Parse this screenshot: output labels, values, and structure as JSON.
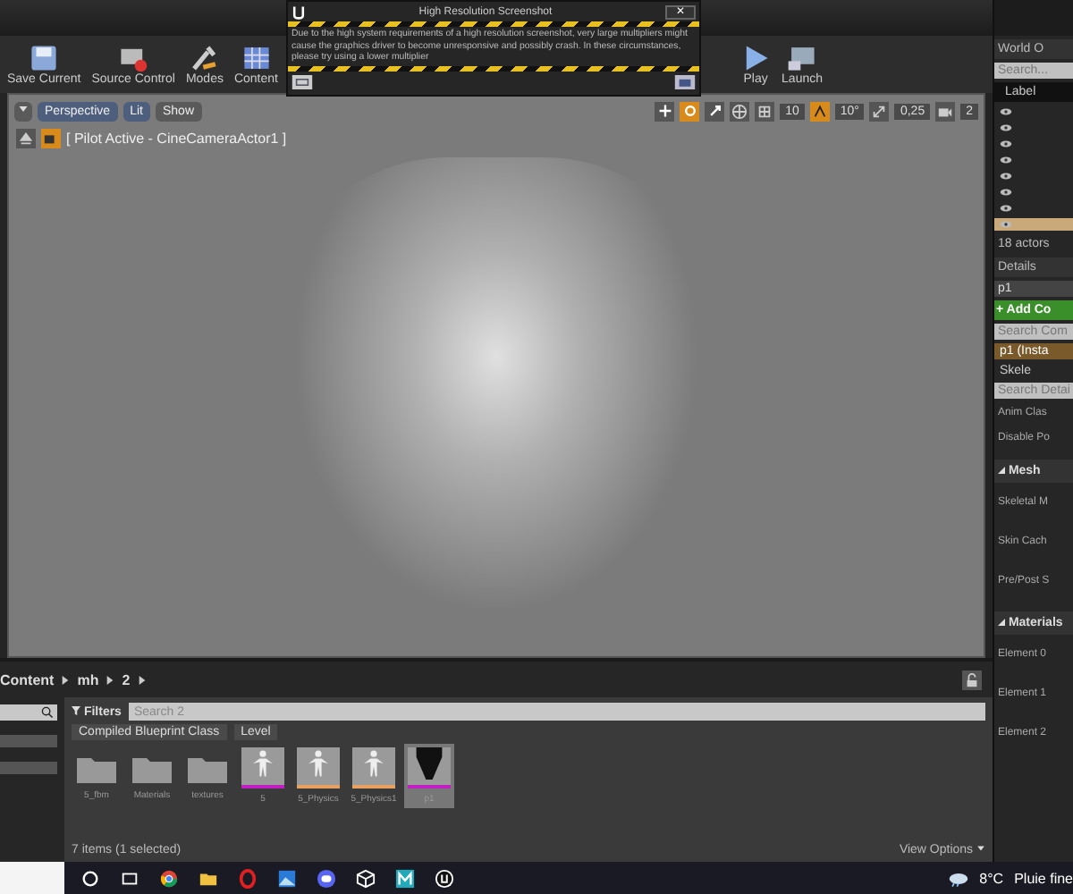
{
  "dialog": {
    "title": "High Resolution Screenshot",
    "close": "✕",
    "message": "Due to the high system requirements of a high resolution screenshot, very large multipliers might cause the graphics driver to become unresponsive and possibly crash. In these circumstances, please try using a lower multiplier"
  },
  "toolbar_left": [
    {
      "label": "Save Current",
      "kind": "save"
    },
    {
      "label": "Source Control",
      "kind": "source"
    },
    {
      "label": "Modes",
      "kind": "modes"
    },
    {
      "label": "Content",
      "kind": "content"
    }
  ],
  "toolbar_right": [
    {
      "label": "Play",
      "kind": "play"
    },
    {
      "label": "Launch",
      "kind": "launch"
    }
  ],
  "viewport": {
    "buttons": [
      {
        "label": "Perspective",
        "kind": "perspective"
      },
      {
        "label": "Lit",
        "kind": "lit"
      },
      {
        "label": "Show",
        "kind": "show"
      }
    ],
    "transform_tools": [
      {
        "kind": "translate",
        "selected": false
      },
      {
        "kind": "rotate",
        "selected": true
      },
      {
        "kind": "scale",
        "selected": false
      }
    ],
    "grid_snap": "10",
    "rotation_snap": "10°",
    "scale_snap": "0,25",
    "camera_speed": "2",
    "pilot": "[ Pilot Active - CineCameraActor1 ]"
  },
  "content_browser": {
    "path": [
      "Content",
      "mh",
      "2"
    ],
    "filters": "Filters",
    "search_placeholder": "Search 2",
    "tags": [
      "Compiled Blueprint Class",
      "Level"
    ],
    "items": [
      {
        "name": "5_fbm",
        "kind": "folder",
        "selected": false
      },
      {
        "name": "Materials",
        "kind": "folder",
        "selected": false
      },
      {
        "name": "textures",
        "kind": "folder",
        "selected": false
      },
      {
        "name": "5",
        "kind": "mesh",
        "color": "#c21fc2",
        "selected": false
      },
      {
        "name": "5_Physics",
        "kind": "mesh",
        "color": "#e8a060",
        "selected": false
      },
      {
        "name": "5_Physics1",
        "kind": "mesh",
        "color": "#e8a060",
        "selected": false
      },
      {
        "name": "p1",
        "kind": "level",
        "color": "#c21fc2",
        "selected": true
      }
    ],
    "status": "7 items (1 selected)",
    "view_options": "View Options"
  },
  "outliner": {
    "title": "World O",
    "search_placeholder": "Search...",
    "column": "Label",
    "rows": [
      {
        "selected": false
      },
      {
        "selected": false
      },
      {
        "selected": false
      },
      {
        "selected": false
      },
      {
        "selected": false
      },
      {
        "selected": false
      },
      {
        "selected": false
      },
      {
        "selected": true
      }
    ],
    "count": "18 actors"
  },
  "details": {
    "title": "Details",
    "name": "p1",
    "add": "+ Add Co",
    "search_components": "Search Com",
    "components": [
      {
        "label": "p1 (Insta",
        "selected": true
      },
      {
        "label": "Skele",
        "selected": false
      }
    ],
    "search_details": "Search Detai",
    "props": [
      "Anim Clas",
      "Disable Po"
    ],
    "sections": [
      {
        "title": "Mesh",
        "props": [
          "Skeletal M",
          "Skin Cach",
          "Pre/Post S"
        ]
      },
      {
        "title": "Materials",
        "props": [
          "Element 0",
          "Element 1",
          "Element 2"
        ]
      }
    ]
  },
  "taskbar": {
    "apps": [
      {
        "kind": "search"
      },
      {
        "kind": "taskview"
      },
      {
        "kind": "chrome"
      },
      {
        "kind": "folder"
      },
      {
        "kind": "opera"
      },
      {
        "kind": "photos"
      },
      {
        "kind": "discord"
      },
      {
        "kind": "cube"
      },
      {
        "kind": "m"
      },
      {
        "kind": "unreal"
      }
    ],
    "temperature": "8°C",
    "weather": "Pluie fine"
  }
}
